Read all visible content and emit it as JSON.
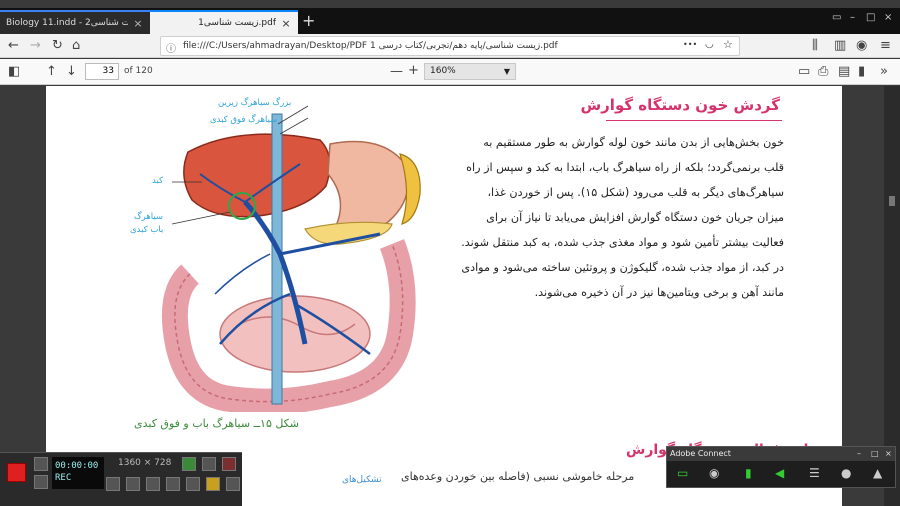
{
  "tabs": [
    {
      "title": "Biology 11.indd - زیست شناسی2.pdf",
      "close": "×"
    },
    {
      "title": "زیست شناسی1.pdf",
      "close": "×"
    }
  ],
  "new_tab": "+",
  "nav": {
    "url": "file:///C:/Users/ahmadrayan/Desktop/PDF 1 زیست شناسی/پایه دهم/تجربی/کتاب درسی.pdf",
    "more": "•••"
  },
  "pdf_toolbar": {
    "page_number": "33",
    "page_total": "of 120",
    "zoom_minus": "—",
    "zoom_plus": "+",
    "zoom_value": "160%"
  },
  "content": {
    "section_title": "گردش خون دستگاه گوارش",
    "paragraph_lines": [
      "خون بخش‌هایی از بدن مانند خون لوله گوارش به طور مستقیم به",
      "قلب برنمی‌گردد؛ بلکه از راه سیاهرگ باب، ابتدا به کبد و سپس از راه",
      "سیاهرگ‌های دیگر به قلب می‌رود (شکل ۱۵). پس از خوردن غذا،",
      "میزان جریان خون دستگاه گوارش افزایش می‌یابد تا نیاز آن برای",
      "فعالیت بیشتر تأمین شود و مواد مغذی جذب شده، به کبد منتقل شوند.",
      "در کبد، از مواد جذب شده، گلیکوژن و پروتئین ساخته می‌شود و موادی",
      "مانند آهن و برخی ویتامین‌ها نیز در آن ذخیره می‌شوند."
    ],
    "figure_labels": {
      "vena_cava": "بزرگ سیاهرگ زیرین",
      "hepatic_vein": "سیاهرگ فوق کبدی",
      "liver": "کبد",
      "portal_vein_line1": "سیاهرگ",
      "portal_vein_line2": "باب کبدی"
    },
    "figure_caption": "شکل ۱۵ــ سیاهرگ باب و فوق کبدی",
    "next_title": "تنظیم فعالیت دستگاه گوارش",
    "next_line": "مرحله خاموشی نسبی (فاصله بین خوردن وعده‌های",
    "next_side": "تشکیل‌های"
  },
  "recorder": {
    "timer_line1": "00:00:00",
    "timer_line2": "REC",
    "resolution": "1360 × 728"
  },
  "adobe": {
    "title": "Adobe Connect",
    "min": "–",
    "max": "□",
    "close": "×"
  }
}
